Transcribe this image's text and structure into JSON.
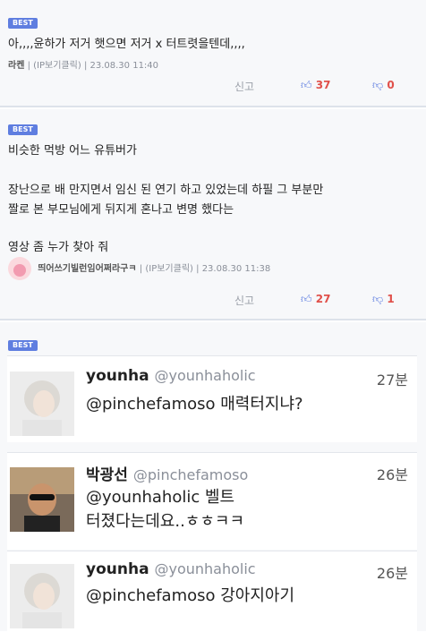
{
  "comments": [
    {
      "badge": "BEST",
      "text": "아,,,,윤하가 저거 햇으면 저거 x 터트렷을텐데,,,,",
      "nick": "라켄",
      "ip": "(IP보기클릭)",
      "date": "23.08.30 11:40",
      "report": "신고",
      "likes": "37",
      "dislikes": "0"
    },
    {
      "badge": "BEST",
      "lines": [
        "비슷한  먹방 어느 유튜버가",
        "장난으로 배 만지면서  임신 된  연기 하고 있었는데   하필  그 부분만",
        "짤로 본 부모님에게 뒤지게 혼나고 변명 했다는",
        "영상 좀  누가 찾아 줘"
      ],
      "nick": "띄어쓰기빌런임어쩌라구ㅋ",
      "ip": "(IP보기클릭)",
      "date": "23.08.30 11:38",
      "report": "신고",
      "likes": "27",
      "dislikes": "1"
    }
  ],
  "best3": {
    "badge": "BEST"
  },
  "tweets": [
    {
      "name": "younha",
      "handle": "@younhaholic",
      "time": "27분",
      "lines": [
        "@pinchefamoso 매력터지냐?"
      ]
    },
    {
      "name": "박광선",
      "handle": "@pinchefamoso",
      "time": "26분",
      "lines": [
        "@younhaholic 벨트",
        "터졌다는데요..ㅎㅎㅋㅋ"
      ]
    },
    {
      "name": "younha",
      "handle": "@younhaholic",
      "time": "26분",
      "lines": [
        "@pinchefamoso 강아지아기"
      ]
    }
  ],
  "icons": {
    "like": "thumbs-up-icon",
    "dislike": "thumbs-down-icon"
  },
  "colors": {
    "accent": "#5f7ee0",
    "count": "#e0504a"
  }
}
